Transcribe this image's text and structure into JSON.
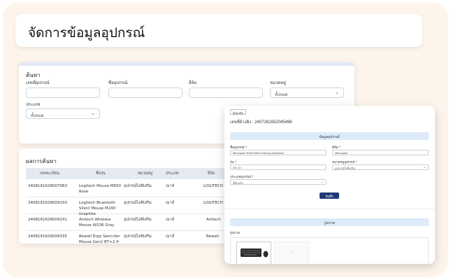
{
  "page_title": "จัดการข้อมูลอุปกรณ์",
  "search": {
    "heading": "ค้นหา",
    "fields": {
      "equipment_no_label": "เลขที่อุปกรณ์",
      "equipment_name_label": "ชื่ออุปกรณ์",
      "brand_label": "ยี่ห้อ",
      "category_label": "หมวดหมู่",
      "category_value": "ทั้งหมด",
      "type_label": "ประเภท",
      "type_value": "ทั้งหมด"
    }
  },
  "results": {
    "heading": "ผลการค้นหา",
    "columns": [
      "เลขทะเบียน",
      "ชื่อรุ่น",
      "หมวดหมู่",
      "ประเภท",
      "ยี่ห้อ"
    ],
    "rows": [
      {
        "id": "2408161628007083",
        "model": "Logitech Mouse M650 Rose",
        "category": "อุปกรณ์ไอทีเสริม",
        "type": "เมาส์",
        "brand": "LOGITECH"
      },
      {
        "id": "2408161628009150",
        "model": "Logitech Bluetooth Silent Mouse M240 Graphite",
        "category": "อุปกรณ์ไอทีเสริม",
        "type": "เมาส์",
        "brand": "LOGITECH"
      },
      {
        "id": "2408161628009241",
        "model": "Anitech Wireless Mouse W236 Gray",
        "category": "อุปกรณ์ไอทีเสริม",
        "type": "เมาส์",
        "brand": "Anitech"
      },
      {
        "id": "2408161628009335",
        "model": "Bewell Ergo Semi-Ver Mouse Gen2 BT+2.4 Black",
        "category": "อุปกรณ์ไอทีเสริม",
        "type": "เมาส์",
        "brand": "Bewell"
      }
    ]
  },
  "modal": {
    "back_label": "ย้อนกลับ",
    "registration_text": "เลขที่อ้างอิง : 2407261652045496",
    "info_section": "ข้อมูลอุปกรณ์",
    "name_label": "ชื่ออุปกรณ์ *",
    "name_value": "Micropack RGB Wired Gaming Keyboard",
    "brand_label": "ยี่ห้อ *",
    "brand_value": "Micropack",
    "model_label": "รุ่น *",
    "model_value": "GK-10",
    "category_label": "หมวดหมู่อุปกรณ์ *",
    "category_value": "อุปกรณ์ไอทีเสริม",
    "type_label": "ประเภทอุปกรณ์ *",
    "type_value": "คีย์บอร์ด",
    "save_label": "บันทึก",
    "image_section": "รูปภาพ",
    "image_label": "รูปภาพ",
    "add_glyph": "+"
  }
}
